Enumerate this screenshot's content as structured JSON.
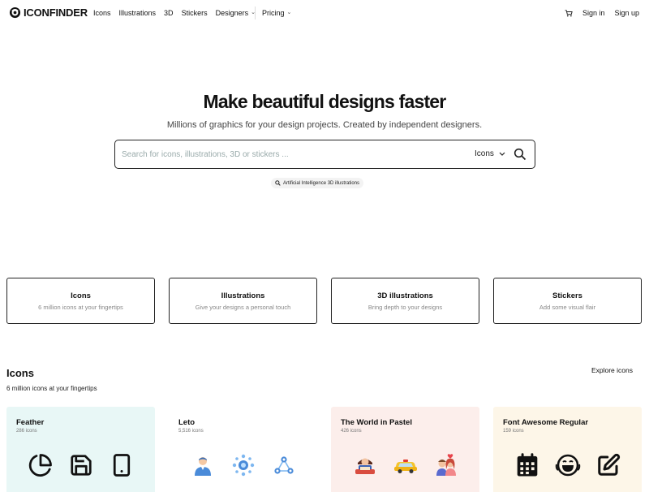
{
  "brand": {
    "name": "ICONFINDER"
  },
  "nav": {
    "links": [
      "Icons",
      "Illustrations",
      "3D",
      "Stickers",
      "Designers"
    ],
    "pricing": "Pricing",
    "sign_in": "Sign in",
    "sign_up": "Sign up"
  },
  "hero": {
    "title_prefix": "Make ",
    "title_highlight": "beautiful designs",
    "title_suffix": " faster",
    "subtitle": "Millions of graphics for your design projects. Created by independent designers.",
    "search_placeholder": "Search for icons, illustrations, 3D or stickers ...",
    "search_type": "Icons",
    "suggestion": "Artificial Intelligence 3D illustrations"
  },
  "categories": [
    {
      "title": "Icons",
      "subtitle": "6 million icons at your fingertips"
    },
    {
      "title": "Illustrations",
      "subtitle": "Give your designs a personal touch"
    },
    {
      "title": "3D illustrations",
      "subtitle": "Bring depth to your designs"
    },
    {
      "title": "Stickers",
      "subtitle": "Add some visual flair"
    }
  ],
  "icons_section": {
    "title": "Icons",
    "subtitle": "6 million icons at your fingertips",
    "explore": "Explore icons"
  },
  "sets": [
    {
      "title": "Feather",
      "count": "286 icons",
      "bg": "#e8f7f6",
      "icons": [
        "pie-chart-icon",
        "save-icon",
        "tablet-icon"
      ]
    },
    {
      "title": "Leto",
      "count": "5,516 icons",
      "bg": "#ffffff",
      "icons": [
        "user-icon",
        "network-icon",
        "share-icon"
      ]
    },
    {
      "title": "The World in Pastel",
      "count": "426 icons",
      "bg": "#fceeeb",
      "icons": [
        "reading-person-icon",
        "taxi-icon",
        "couple-icon"
      ]
    },
    {
      "title": "Font Awesome Regular",
      "count": "159 icons",
      "bg": "#fdf6e8",
      "icons": [
        "calendar-icon",
        "laughing-face-icon",
        "edit-icon"
      ]
    }
  ],
  "colors": {
    "highlight": "#ffd59a",
    "border": "#222222",
    "muted_text": "#888888"
  }
}
